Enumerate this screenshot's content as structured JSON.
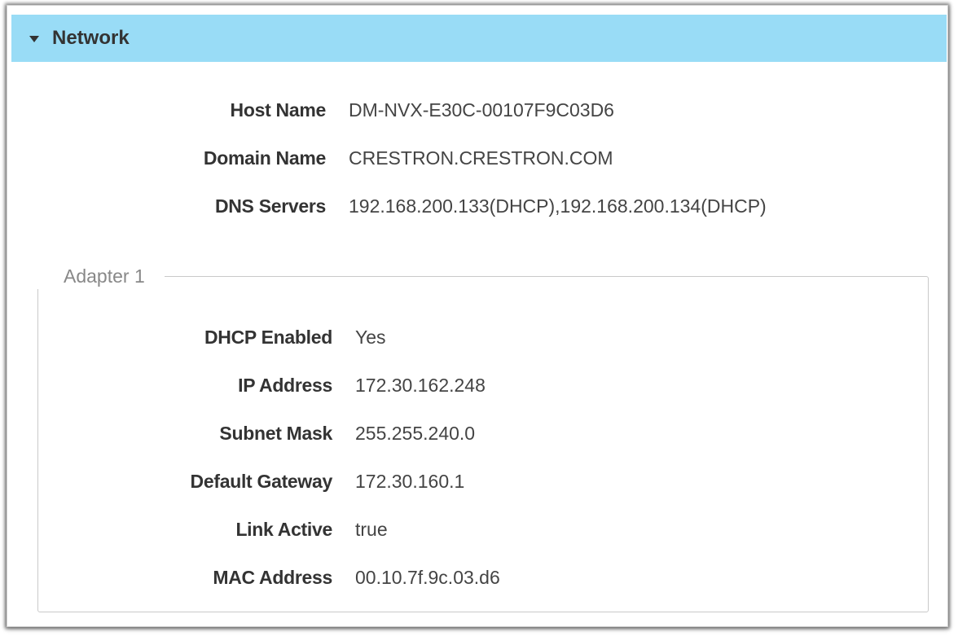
{
  "panel": {
    "title": "Network",
    "collapse_icon": "caret-down-icon"
  },
  "general": [
    {
      "label": "Host Name",
      "value": "DM-NVX-E30C-00107F9C03D6"
    },
    {
      "label": "Domain Name",
      "value": "CRESTRON.CRESTRON.COM"
    },
    {
      "label": "DNS Servers",
      "value": "192.168.200.133(DHCP),192.168.200.134(DHCP)"
    }
  ],
  "adapter": {
    "title": "Adapter 1",
    "fields": [
      {
        "label": "DHCP Enabled",
        "value": "Yes"
      },
      {
        "label": "IP Address",
        "value": "172.30.162.248"
      },
      {
        "label": "Subnet Mask",
        "value": "255.255.240.0"
      },
      {
        "label": "Default Gateway",
        "value": "172.30.160.1"
      },
      {
        "label": "Link Active",
        "value": "true"
      },
      {
        "label": "MAC Address",
        "value": "00.10.7f.9c.03.d6"
      }
    ]
  },
  "colors": {
    "header_bg": "#99dcf6",
    "label_text": "#333333",
    "value_text": "#444444",
    "legend_text": "#888888"
  }
}
